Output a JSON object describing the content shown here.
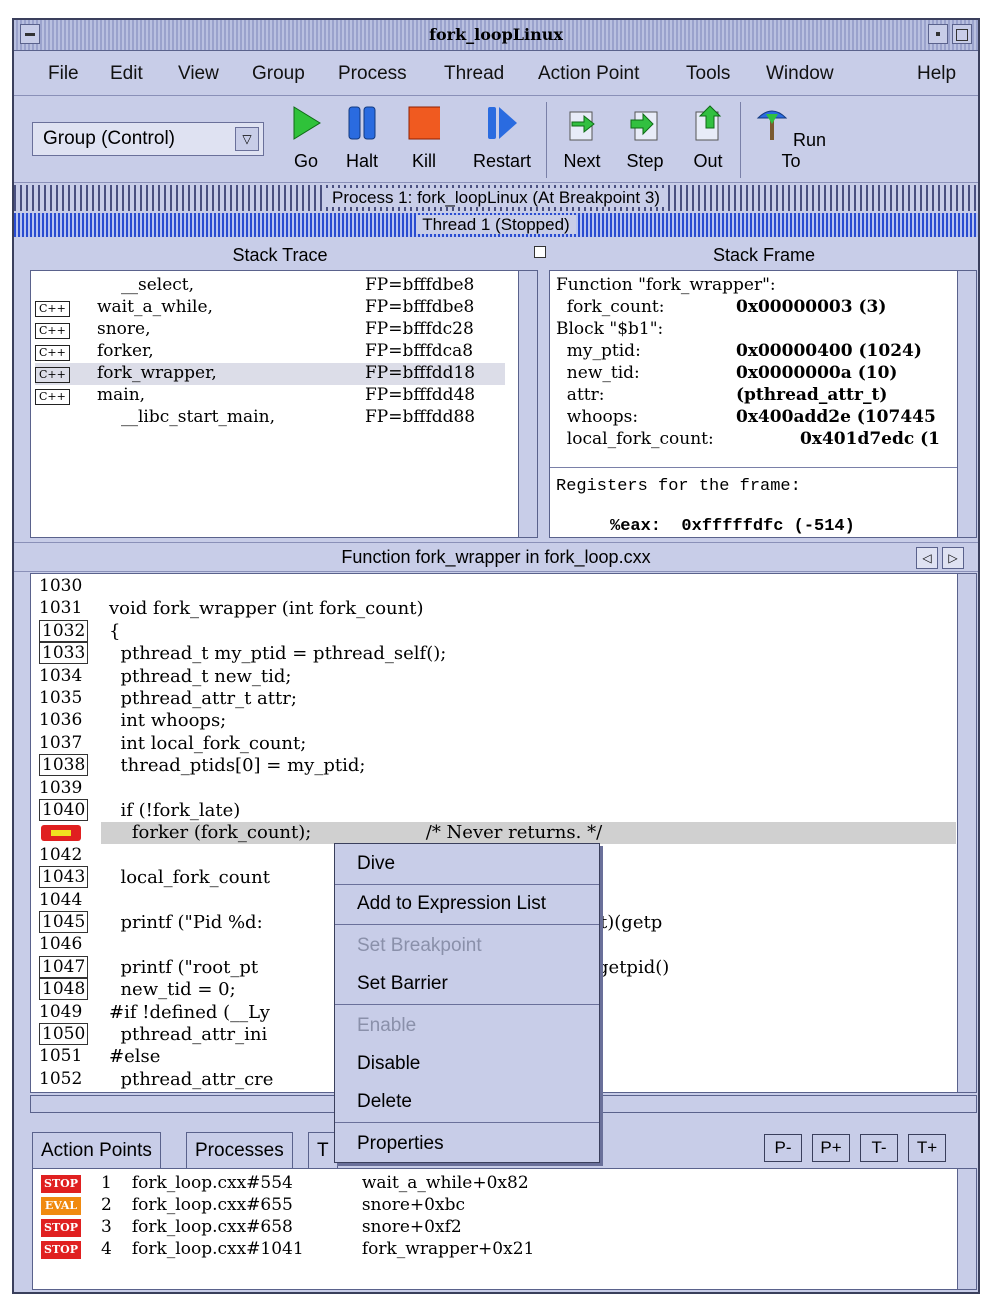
{
  "window": {
    "title": "fork_loopLinux"
  },
  "menu": [
    "File",
    "Edit",
    "View",
    "Group",
    "Process",
    "Thread",
    "Action Point",
    "Tools",
    "Window",
    "Help"
  ],
  "toolbar": {
    "group_value": "Group (Control)",
    "buttons": [
      "Go",
      "Halt",
      "Kill",
      "Restart",
      "Next",
      "Step",
      "Out",
      "Run To"
    ]
  },
  "status": {
    "process": "Process 1: fork_loopLinux (At Breakpoint 3)",
    "thread": "Thread 1 (Stopped)"
  },
  "stack_trace": {
    "title": "Stack Trace",
    "rows": [
      {
        "tag": "",
        "name": "__select,",
        "fp": "FP=bfffdbe8"
      },
      {
        "tag": "C++",
        "name": "wait_a_while,",
        "fp": "FP=bfffdbe8"
      },
      {
        "tag": "C++",
        "name": "snore,",
        "fp": "FP=bfffdc28"
      },
      {
        "tag": "C++",
        "name": "forker,",
        "fp": "FP=bfffdca8"
      },
      {
        "tag": "C++",
        "name": "fork_wrapper,",
        "fp": "FP=bfffdd18"
      },
      {
        "tag": "C++",
        "name": "main,",
        "fp": "FP=bfffdd48"
      },
      {
        "tag": "",
        "name": "__libc_start_main,",
        "fp": "FP=bfffdd88"
      }
    ]
  },
  "stack_frame": {
    "title": "Stack Frame",
    "lines": [
      {
        "label": "Function \"fork_wrapper\":",
        "value": ""
      },
      {
        "label": "  fork_count:",
        "value": "0x00000003 (3)"
      },
      {
        "label": "Block \"$b1\":",
        "value": ""
      },
      {
        "label": "  my_ptid:",
        "value": "0x00000400 (1024)"
      },
      {
        "label": "  new_tid:",
        "value": "0x0000000a (10)"
      },
      {
        "label": "  attr:",
        "value": "(pthread_attr_t)"
      },
      {
        "label": "  whoops:",
        "value": "0x400add2e (107445"
      },
      {
        "label": "  local_fork_count:",
        "value": "0x401d7edc (1"
      }
    ],
    "registers": "Registers for the frame:",
    "reg_partial": "%eax:  0xfffffdfc (-514)"
  },
  "source": {
    "title": "Function fork_wrapper in fork_loop.cxx",
    "lines": [
      {
        "n": "1030",
        "code": ""
      },
      {
        "n": "1031",
        "code": "void fork_wrapper (int fork_count)"
      },
      {
        "n": "1032",
        "code": "{"
      },
      {
        "n": "1033",
        "code": "  pthread_t my_ptid = pthread_self();"
      },
      {
        "n": "1034",
        "code": "  pthread_t new_tid;"
      },
      {
        "n": "1035",
        "code": "  pthread_attr_t attr;"
      },
      {
        "n": "1036",
        "code": "  int whoops;"
      },
      {
        "n": "1037",
        "code": "  int local_fork_count;"
      },
      {
        "n": "1038",
        "code": "  thread_ptids[0] = my_ptid;"
      },
      {
        "n": "1039",
        "code": ""
      },
      {
        "n": "1040",
        "code": "  if (!fork_late)"
      },
      {
        "n": "",
        "code": "    forker (fork_count);                    /* Never returns. */"
      },
      {
        "n": "1042",
        "code": ""
      },
      {
        "n": "1043",
        "code": "  local_fork_count                          k_count : 1;"
      },
      {
        "n": "1044",
        "code": ""
      },
      {
        "n": "1045",
        "code": "  printf (\"Pid %d:                          thread to fork\\n\", (int)(getp"
      },
      {
        "n": "1046",
        "code": ""
      },
      {
        "n": "1047",
        "code": "  printf (\"root_pt                          long)(my_ptid), (int)(getpid()"
      },
      {
        "n": "1048",
        "code": "  new_tid = 0;"
      },
      {
        "n": "1049",
        "code": "#if !defined (__Ly"
      },
      {
        "n": "1050",
        "code": "  pthread_attr_ini"
      },
      {
        "n": "1051",
        "code": "#else"
      },
      {
        "n": "1052",
        "code": "  pthread_attr_cre"
      }
    ]
  },
  "context_menu": [
    "Dive",
    "Add to Expression List",
    "Set Breakpoint",
    "Set Barrier",
    "Enable",
    "Disable",
    "Delete",
    "Properties"
  ],
  "tabs": [
    "Action Points",
    "Processes",
    "T"
  ],
  "nav_buttons": [
    "P-",
    "P+",
    "T-",
    "T+"
  ],
  "action_points": [
    {
      "badge": "STOP",
      "color": "#e02020",
      "id": "1",
      "loc": "fork_loop.cxx#554",
      "where": "wait_a_while+0x82"
    },
    {
      "badge": "EVAL",
      "color": "#f08a10",
      "id": "2",
      "loc": "fork_loop.cxx#655",
      "where": "snore+0xbc"
    },
    {
      "badge": "STOP",
      "color": "#e02020",
      "id": "3",
      "loc": "fork_loop.cxx#658",
      "where": "snore+0xf2"
    },
    {
      "badge": "STOP",
      "color": "#e02020",
      "id": "4",
      "loc": "fork_loop.cxx#1041",
      "where": "fork_wrapper+0x21"
    }
  ]
}
